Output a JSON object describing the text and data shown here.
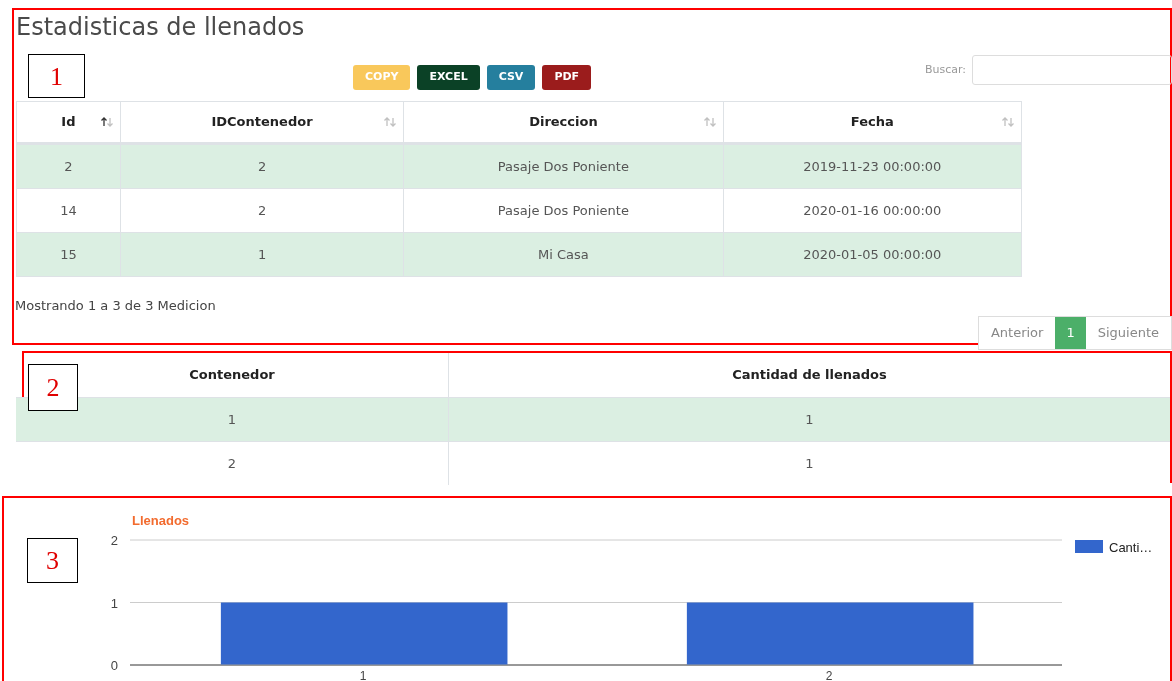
{
  "title": "Estadisticas de llenados",
  "annotations": [
    "1",
    "2",
    "3"
  ],
  "export_buttons": [
    {
      "label": "COPY",
      "color": "#f9c85b"
    },
    {
      "label": "EXCEL",
      "color": "#0b4126"
    },
    {
      "label": "CSV",
      "color": "#257f9e"
    },
    {
      "label": "PDF",
      "color": "#9b1c1c"
    }
  ],
  "search": {
    "label": "Buscar:"
  },
  "table": {
    "columns": [
      {
        "label": "Id",
        "sorted": true
      },
      {
        "label": "IDContenedor",
        "sorted": false
      },
      {
        "label": "Direccion",
        "sorted": false
      },
      {
        "label": "Fecha",
        "sorted": false
      }
    ],
    "rows": [
      [
        "2",
        "2",
        "Pasaje Dos Poniente",
        "2019-11-23 00:00:00"
      ],
      [
        "14",
        "2",
        "Pasaje Dos Poniente",
        "2020-01-16 00:00:00"
      ],
      [
        "15",
        "1",
        "Mi Casa",
        "2020-01-05 00:00:00"
      ]
    ]
  },
  "info": "Mostrando 1 a 3 de 3 Medicion",
  "pagination": [
    {
      "label": "Anterior",
      "selected": false
    },
    {
      "label": "1",
      "selected": true
    },
    {
      "label": "Siguiente",
      "selected": false
    }
  ],
  "summary_table": {
    "columns": [
      "Contenedor",
      "Cantidad de llenados"
    ],
    "rows": [
      [
        "1",
        "1"
      ],
      [
        "2",
        "1"
      ]
    ]
  },
  "chart": {
    "chart_data": {
      "type": "bar",
      "title": "Llenados",
      "categories": [
        "1",
        "2"
      ],
      "series": [
        {
          "name": "Canti…",
          "color": "#3366cc",
          "values": [
            1,
            1
          ]
        }
      ],
      "ylim": [
        0,
        2
      ],
      "yticks": [
        0,
        1,
        2
      ]
    }
  }
}
